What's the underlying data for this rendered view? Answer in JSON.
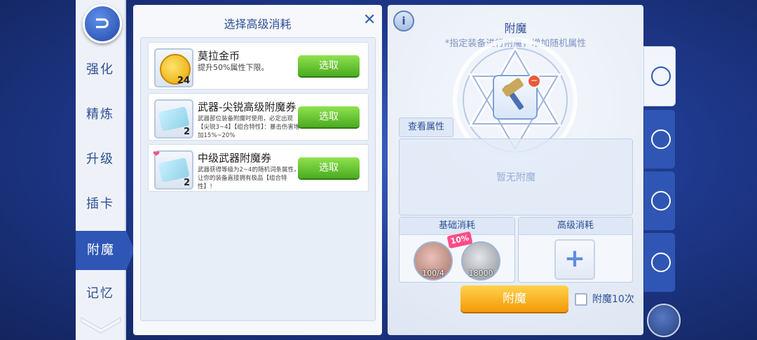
{
  "nav": {
    "items": [
      {
        "label": "强化"
      },
      {
        "label": "精炼"
      },
      {
        "label": "升级"
      },
      {
        "label": "插卡"
      },
      {
        "label": "附魔"
      },
      {
        "label": "记忆"
      }
    ],
    "active": "附魔"
  },
  "select_panel": {
    "title": "选择高级消耗",
    "items": [
      {
        "name": "莫拉金币",
        "desc": "提升50%属性下限。",
        "qty": "24",
        "button": "选取"
      },
      {
        "name": "武器-尖锐高级附魔券",
        "desc": "武器部位装备附魔时使用，必定出现【尖锐3~4】【组合特性】：暴击伤害增加15%~20%",
        "qty": "2",
        "button": "选取"
      },
      {
        "name": "中级武器附魔券",
        "desc": "武器获得等级为2~4的随机词条属性，让你的装备直接拥有极品【组合特性】！",
        "qty": "2",
        "button": "选取"
      }
    ]
  },
  "enchant_panel": {
    "info_icon": "i",
    "title": "附魔",
    "subtitle": "*指定装备进行附魔，增加随机属性",
    "view_attr": "查看属性",
    "empty_text": "暂无附魔",
    "basic_cost": {
      "label": "基础消耗",
      "items": [
        {
          "icon": "cat-coin-icon",
          "qty": "100/4"
        },
        {
          "icon": "zeny-coin-icon",
          "qty": "18000"
        }
      ],
      "sale_tag": "10%"
    },
    "advanced_cost": {
      "label": "高级消耗",
      "add_symbol": "+"
    },
    "enchant_button": "附魔",
    "checkbox_label": "附魔10次",
    "checkbox_checked": false
  },
  "side_tabs": [
    "enchant-tab-icon",
    "tab-2-icon",
    "tab-3-icon",
    "tab-4-icon"
  ],
  "colors": {
    "primary": "#2f56b5",
    "confirm_green": "#4aab20",
    "enchant_orange": "#f39a07"
  }
}
